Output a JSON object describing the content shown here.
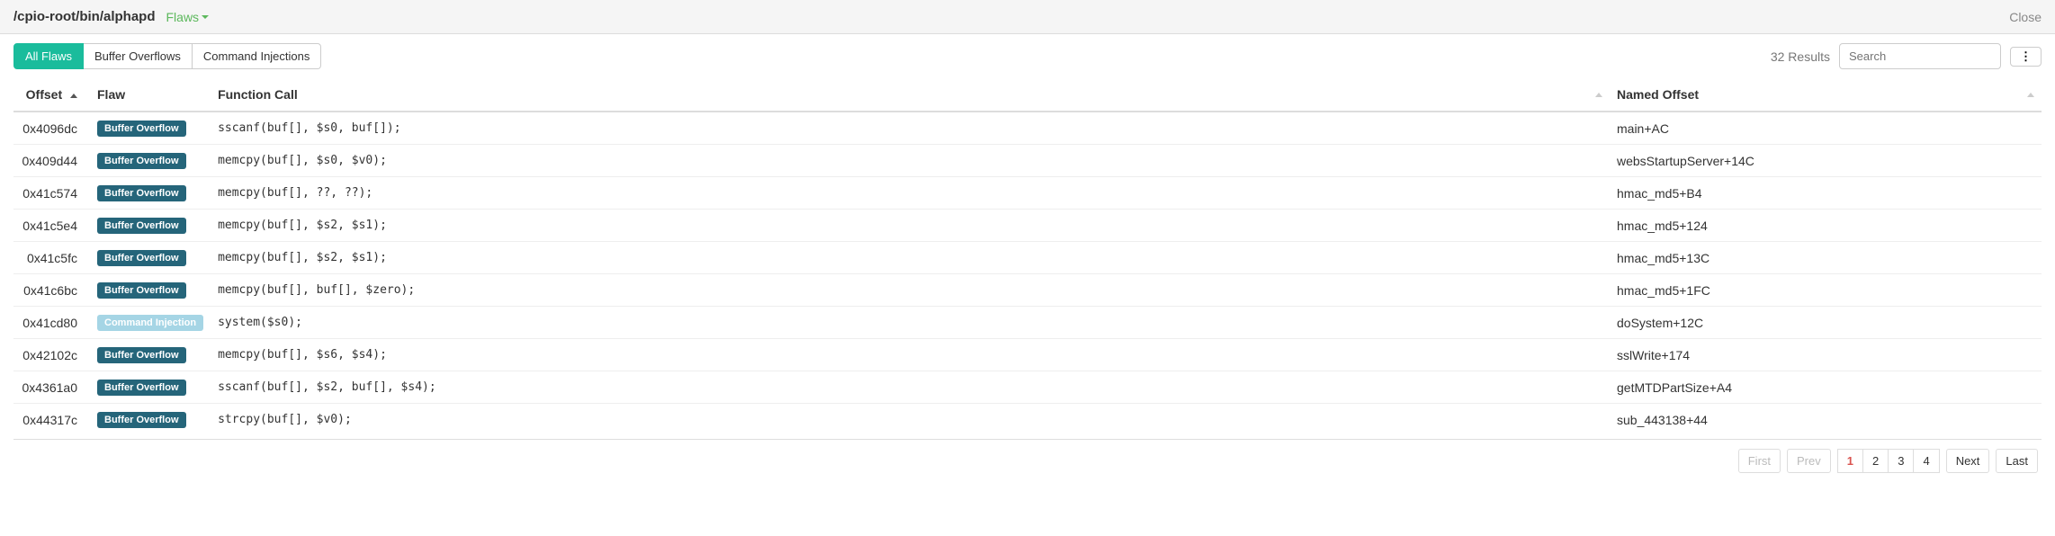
{
  "header": {
    "path": "/cpio-root/bin/alphapd",
    "dropdown_label": "Flaws",
    "close_label": "Close"
  },
  "tabs": {
    "all": "All Flaws",
    "buffer": "Buffer Overflows",
    "command": "Command Injections"
  },
  "toolbar": {
    "results_text": "32 Results",
    "search_placeholder": "Search"
  },
  "columns": {
    "offset": "Offset",
    "flaw": "Flaw",
    "call": "Function Call",
    "named": "Named Offset"
  },
  "badges": {
    "buffer": "Buffer Overflow",
    "command": "Command Injection"
  },
  "rows": [
    {
      "offset": "0x4096dc",
      "type": "buffer",
      "call": "sscanf(buf[], $s0, buf[]);",
      "named": "main+AC"
    },
    {
      "offset": "0x409d44",
      "type": "buffer",
      "call": "memcpy(buf[], $s0, $v0);",
      "named": "websStartupServer+14C"
    },
    {
      "offset": "0x41c574",
      "type": "buffer",
      "call": "memcpy(buf[], ??, ??);",
      "named": "hmac_md5+B4"
    },
    {
      "offset": "0x41c5e4",
      "type": "buffer",
      "call": "memcpy(buf[], $s2, $s1);",
      "named": "hmac_md5+124"
    },
    {
      "offset": "0x41c5fc",
      "type": "buffer",
      "call": "memcpy(buf[], $s2, $s1);",
      "named": "hmac_md5+13C"
    },
    {
      "offset": "0x41c6bc",
      "type": "buffer",
      "call": "memcpy(buf[], buf[], $zero);",
      "named": "hmac_md5+1FC"
    },
    {
      "offset": "0x41cd80",
      "type": "command",
      "call": "system($s0);",
      "named": "doSystem+12C"
    },
    {
      "offset": "0x42102c",
      "type": "buffer",
      "call": "memcpy(buf[], $s6, $s4);",
      "named": "sslWrite+174"
    },
    {
      "offset": "0x4361a0",
      "type": "buffer",
      "call": "sscanf(buf[], $s2, buf[], $s4);",
      "named": "getMTDPartSize+A4"
    },
    {
      "offset": "0x44317c",
      "type": "buffer",
      "call": "strcpy(buf[], $v0);",
      "named": "sub_443138+44"
    }
  ],
  "pagination": {
    "first": "First",
    "prev": "Prev",
    "pages": [
      "1",
      "2",
      "3",
      "4"
    ],
    "next": "Next",
    "last": "Last",
    "active": "1"
  }
}
